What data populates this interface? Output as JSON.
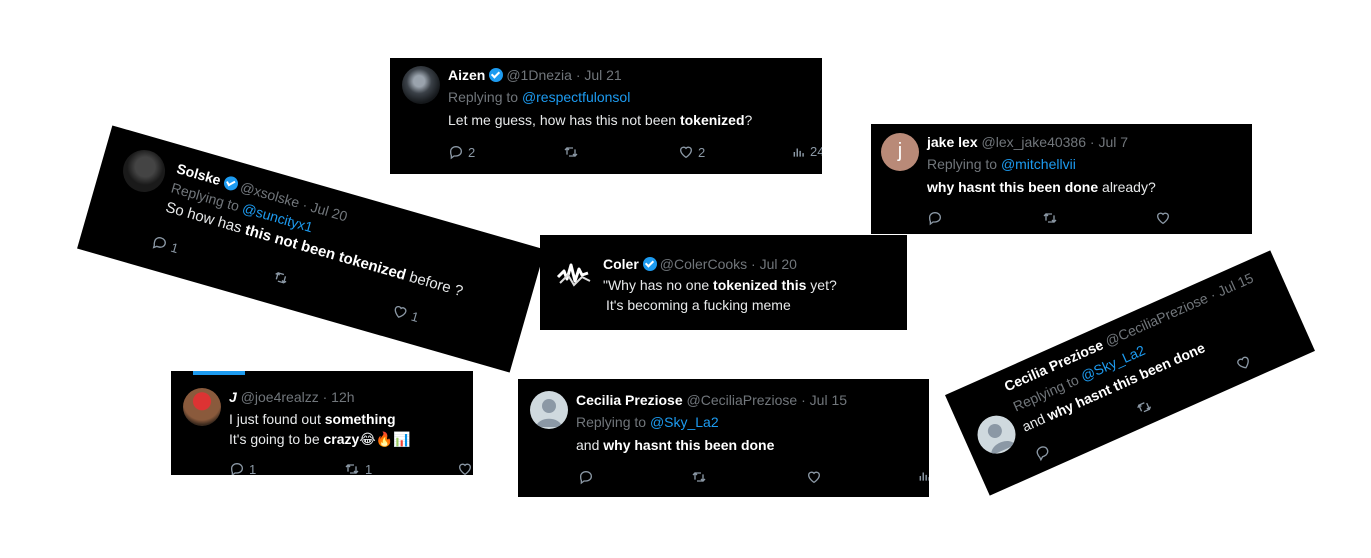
{
  "tweets": {
    "aizen": {
      "name": "Aizen",
      "handle": "@1Dnezia",
      "date": "· Jul 21",
      "replying_prefix": "Replying to",
      "replying_to": "@respectfulonsol",
      "text_parts": [
        "Let me guess, how has ",
        "this not been ",
        "tokenized",
        "?"
      ],
      "replies": "2",
      "likes": "2",
      "views": "24"
    },
    "jakelex": {
      "name": "jake lex",
      "handle": "@lex_jake40386",
      "date": "· Jul 7",
      "avatar_letter": "j",
      "replying_prefix": "Replying to",
      "replying_to": "@mitchellvii",
      "text_parts": [
        "why hasnt this been done",
        " already?"
      ]
    },
    "solske": {
      "name": "Solske",
      "handle": "@xsolske",
      "date": "· Jul 20",
      "replying_prefix": "Replying to",
      "replying_to": "@suncityx1",
      "text_parts": [
        "So how has ",
        "this not been tokenized",
        " before ?"
      ],
      "replies": "1",
      "likes": "1"
    },
    "coler": {
      "name": "Coler",
      "handle": "@ColerCooks",
      "date": "· Jul 20",
      "text_line1_parts": [
        "\"Why has no one ",
        "tokenized this",
        " yet?"
      ],
      "text_line2": "It's becoming a fucking meme"
    },
    "joe": {
      "name": "J",
      "handle": "@joe4realzz",
      "date": "· 12h",
      "text_line1_parts": [
        "I just found out ",
        "something"
      ],
      "text_line2_parts": [
        "It's going to be ",
        "crazy",
        "😂🔥📊"
      ],
      "replies": "1",
      "retweets": "1"
    },
    "cecilia1": {
      "name": "Cecilia Preziose",
      "handle": "@CeciliaPreziose",
      "date": "· Jul 15",
      "replying_prefix": "Replying to",
      "replying_to": "@Sky_La2",
      "text_parts": [
        "and ",
        "why hasnt this been done"
      ]
    },
    "cecilia2": {
      "name": "Cecilia Preziose",
      "handle": "@CeciliaPreziose",
      "date": "· Jul 15",
      "replying_prefix": "Replying to",
      "replying_to": "@Sky_La2",
      "text_parts": [
        "and ",
        "why hasnt this been done"
      ]
    }
  },
  "colors": {
    "card_bg": "#000000",
    "link": "#1d9bf0",
    "muted": "#71767b",
    "verified": "#1d9bf0"
  },
  "icons": [
    "reply-icon",
    "retweet-icon",
    "like-icon",
    "views-icon",
    "verified-badge-icon"
  ]
}
